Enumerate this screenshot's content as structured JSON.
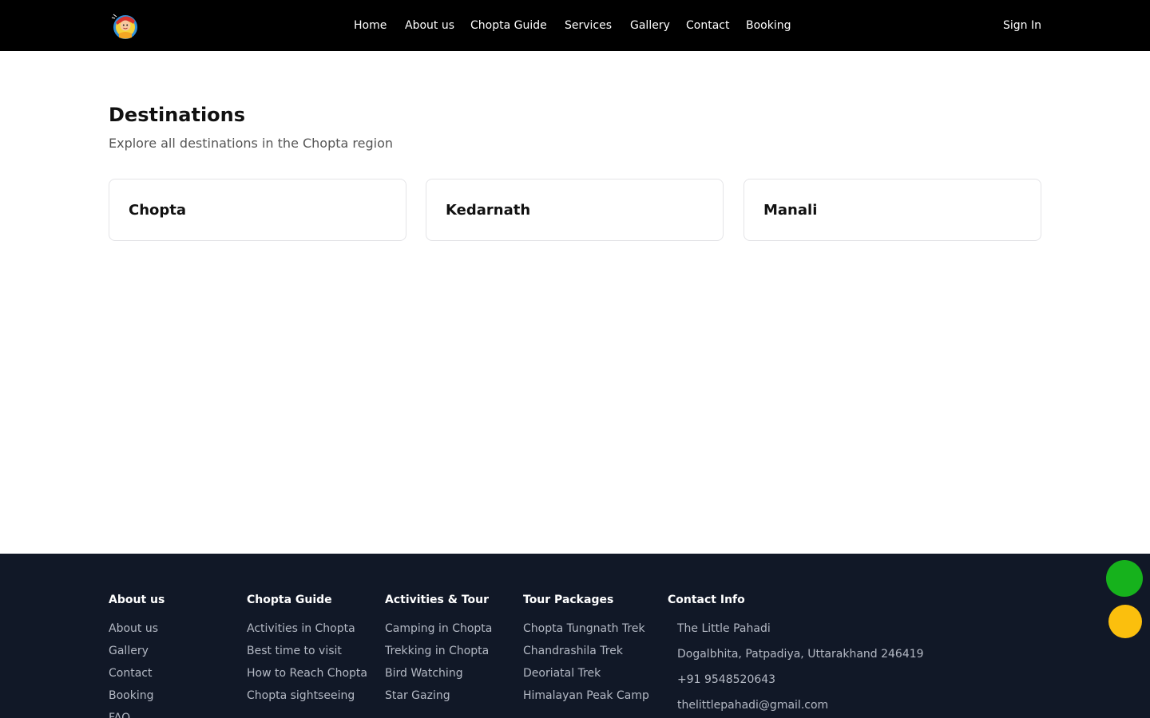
{
  "nav": {
    "links": [
      "Home",
      "About us",
      "Chopta Guide",
      "Services",
      "Gallery",
      "Contact",
      "Booking"
    ],
    "signin": "Sign In"
  },
  "main": {
    "title": "Destinations",
    "subtitle": "Explore all destinations in the Chopta region",
    "cards": [
      "Chopta",
      "Kedarnath",
      "Manali"
    ]
  },
  "footer": {
    "columns": [
      {
        "heading": "About us",
        "items": [
          "About us",
          "Gallery",
          "Contact",
          "Booking",
          "FAQ"
        ]
      },
      {
        "heading": "Chopta Guide",
        "items": [
          "Activities in Chopta",
          "Best time to visit",
          "How to Reach Chopta",
          "Chopta sightseeing"
        ]
      },
      {
        "heading": "Activities & Tour",
        "items": [
          "Camping in Chopta",
          "Trekking in Chopta",
          "Bird Watching",
          "Star Gazing"
        ]
      },
      {
        "heading": "Tour Packages",
        "items": [
          "Chopta Tungnath Trek",
          "Chandrashila Trek",
          "Deoriatal Trek",
          "Himalayan Peak Camp"
        ]
      }
    ],
    "contact": {
      "heading": "Contact Info",
      "items": [
        "The Little Pahadi",
        "Dogalbhita, Patpadiya, Uttarakhand 246419",
        "+91 9548520643",
        "thelittlepahadi@gmail.com"
      ]
    }
  },
  "colors": {
    "nav_bg": "#000000",
    "footer_bg": "#111827",
    "whatsapp_button": "#16b21c",
    "call_button": "#fbbf0d"
  },
  "icons": {
    "logo": "mascot-logo-icon",
    "float_green": "whatsapp-button",
    "float_yellow": "call-button"
  }
}
